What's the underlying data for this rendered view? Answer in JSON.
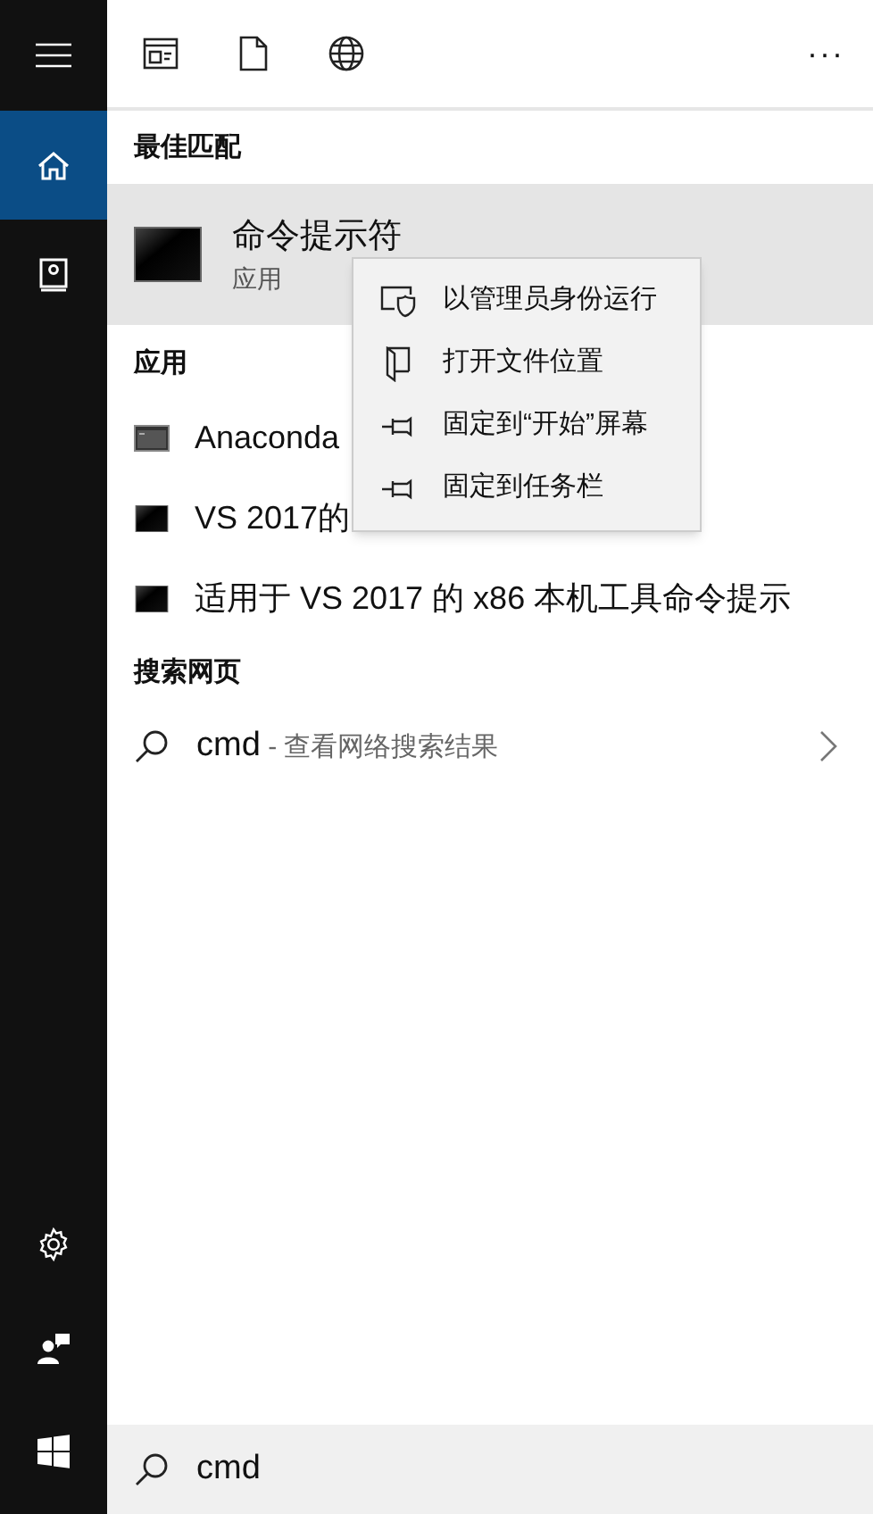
{
  "sidebar": {
    "top_items": [
      {
        "kind": "home",
        "selected": true
      },
      {
        "kind": "notebook",
        "selected": false
      }
    ],
    "bottom_items": [
      {
        "kind": "settings"
      },
      {
        "kind": "feedback"
      },
      {
        "kind": "start"
      }
    ]
  },
  "toolbar": {
    "filters": [
      {
        "kind": "apps"
      },
      {
        "kind": "documents"
      },
      {
        "kind": "web"
      }
    ],
    "more": "···"
  },
  "best_match": {
    "heading": "最佳匹配",
    "item": {
      "title": "命令提示符",
      "subtitle": "应用",
      "selected": true
    }
  },
  "apps": {
    "heading": "应用",
    "items": [
      {
        "title": "Anaconda",
        "kind": "console"
      },
      {
        "title": "VS 2017的",
        "kind": "terminal"
      },
      {
        "title": "适用于 VS 2017 的 x86 本机工具命令提示",
        "kind": "terminal"
      }
    ]
  },
  "web_search": {
    "heading": "搜索网页",
    "item": {
      "query": "cmd",
      "suffix": " - 查看网络搜索结果"
    }
  },
  "context_menu": {
    "items": [
      {
        "kind": "admin",
        "label": "以管理员身份运行"
      },
      {
        "kind": "folder",
        "label": "打开文件位置"
      },
      {
        "kind": "pin",
        "label": "固定到“开始”屏幕"
      },
      {
        "kind": "pin",
        "label": "固定到任务栏"
      }
    ]
  },
  "search_box": {
    "value": "cmd"
  }
}
